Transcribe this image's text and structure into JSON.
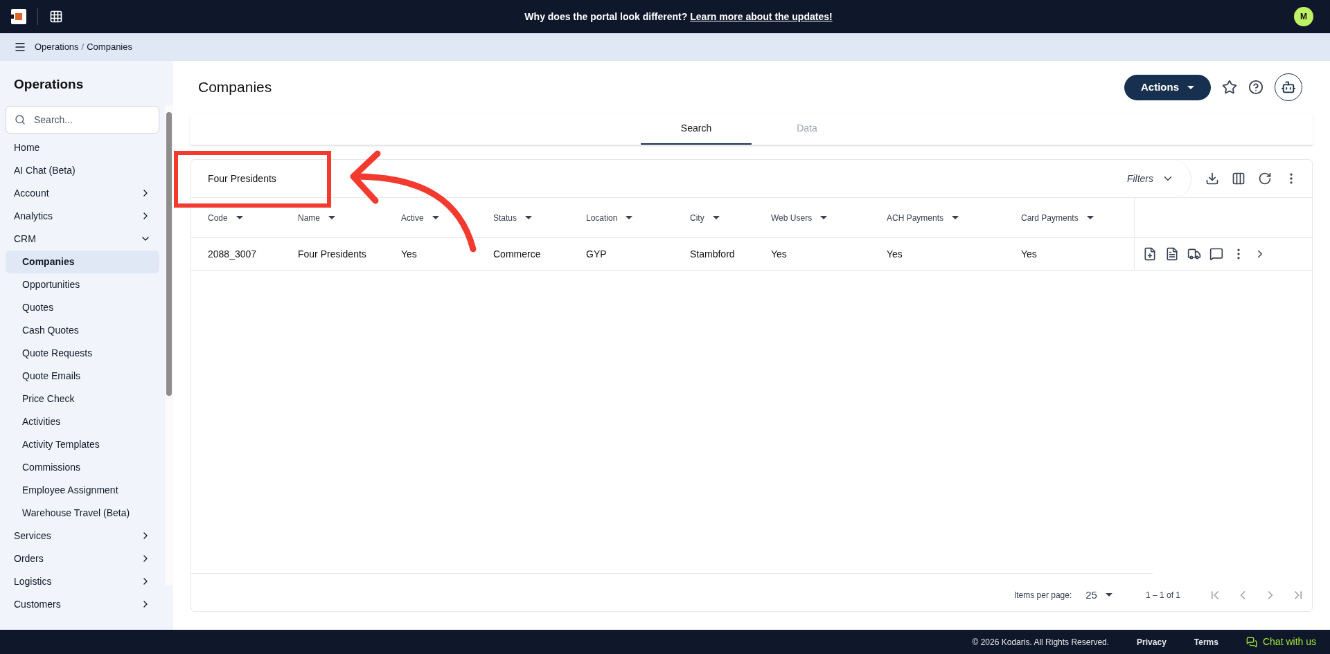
{
  "banner": {
    "text": "Why does the portal look different?",
    "link": "Learn more about the updates!"
  },
  "user": {
    "initial": "M"
  },
  "breadcrumb": {
    "separator": "/",
    "items": [
      "Operations",
      "Companies"
    ]
  },
  "sidebar": {
    "title": "Operations",
    "search": {
      "placeholder": "Search..."
    },
    "items": [
      {
        "label": "Home",
        "selected": false
      },
      {
        "label": "AI Chat (Beta)",
        "selected": false
      },
      {
        "label": "Account",
        "selected": false,
        "expanded": false
      },
      {
        "label": "Analytics",
        "selected": false,
        "expanded": false
      },
      {
        "label": "CRM",
        "selected": false,
        "expanded": true,
        "children": [
          {
            "label": "Companies",
            "selected": true
          },
          {
            "label": "Opportunities",
            "selected": false
          },
          {
            "label": "Quotes",
            "selected": false
          },
          {
            "label": "Cash Quotes",
            "selected": false
          },
          {
            "label": "Quote Requests",
            "selected": false
          },
          {
            "label": "Quote Emails",
            "selected": false
          },
          {
            "label": "Price Check",
            "selected": false
          },
          {
            "label": "Activities",
            "selected": false
          },
          {
            "label": "Activity Templates",
            "selected": false
          },
          {
            "label": "Commissions",
            "selected": false
          },
          {
            "label": "Employee Assignment",
            "selected": false
          },
          {
            "label": "Warehouse Travel (Beta)",
            "selected": false
          }
        ]
      },
      {
        "label": "Services",
        "selected": false,
        "expanded": false
      },
      {
        "label": "Orders",
        "selected": false,
        "expanded": false
      },
      {
        "label": "Logistics",
        "selected": false,
        "expanded": false
      },
      {
        "label": "Customers",
        "selected": false,
        "expanded": false
      }
    ]
  },
  "page": {
    "title": "Companies",
    "actions": "Actions"
  },
  "tabs": [
    {
      "label": "Search",
      "selected": true
    },
    {
      "label": "Data",
      "selected": false
    }
  ],
  "table": {
    "search_value": "Four Presidents",
    "filters": "Filters",
    "columns": [
      "Code",
      "Name",
      "Active",
      "Status",
      "Location",
      "City",
      "Web Users",
      "ACH Payments",
      "Card Payments"
    ],
    "rows": [
      [
        "2088_3007",
        "Four Presidents",
        "Yes",
        "Commerce",
        "GYP",
        "Stambford",
        "Yes",
        "Yes",
        "Yes"
      ]
    ]
  },
  "pagination": {
    "label": "Items per page:",
    "page_size": "25",
    "range": "1 – 1 of 1"
  },
  "footer": {
    "copyright": "© 2026 Kodaris. All Rights Reserved.",
    "links": [
      "Privacy",
      "Terms"
    ],
    "chat": "Chat with us"
  }
}
